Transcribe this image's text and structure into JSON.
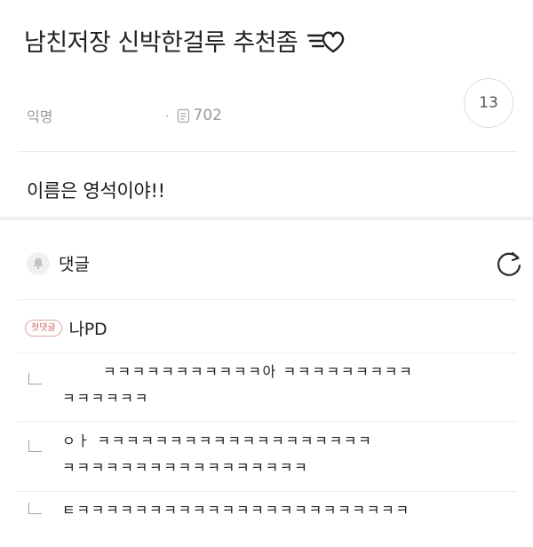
{
  "post": {
    "title": "남친저장 신박한걸루 추천좀",
    "title_icon": "speeding-heart-icon",
    "author": "익명",
    "views_icon": "document-icon",
    "views": "702",
    "comment_count": "13",
    "body": "이름은 영석이야!!"
  },
  "comments_section": {
    "label": "댓글",
    "bell_icon": "bell-icon",
    "refresh_icon": "refresh-icon"
  },
  "first_comment": {
    "badge": "첫댓글",
    "author": "나PD"
  },
  "replies": [
    {
      "line1": "ㅋㅋㅋㅋㅋㅋㅋㅋㅋㅋㅋ아 ㅋㅋㅋㅋㅋㅋㅋㅋㅋ",
      "line2": "ㅋㅋㅋㅋㅋㅋ"
    },
    {
      "line1": "ㅇㅏ ㅋㅋㅋㅋㅋㅋㅋㅋㅋㅋㅋㅋㅋㅋㅋㅋㅋㅋㅋ",
      "line2": "ㅋㅋㅋㅋㅋㅋㅋㅋㅋㅋㅋㅋㅋㅋㅋㅋㅋ"
    },
    {
      "line1": "ㅌㅋㅋㅋㅋㅋㅋㅋㅋㅋㅋㅋㅋㅋㅋㅋㅋㅋㅋㅋㅋㅋㅋㅋ"
    }
  ],
  "colors": {
    "badge_border": "#e3a6a6",
    "badge_text": "#d46565",
    "muted_text": "#9a9a9a",
    "divider": "#ececec"
  }
}
